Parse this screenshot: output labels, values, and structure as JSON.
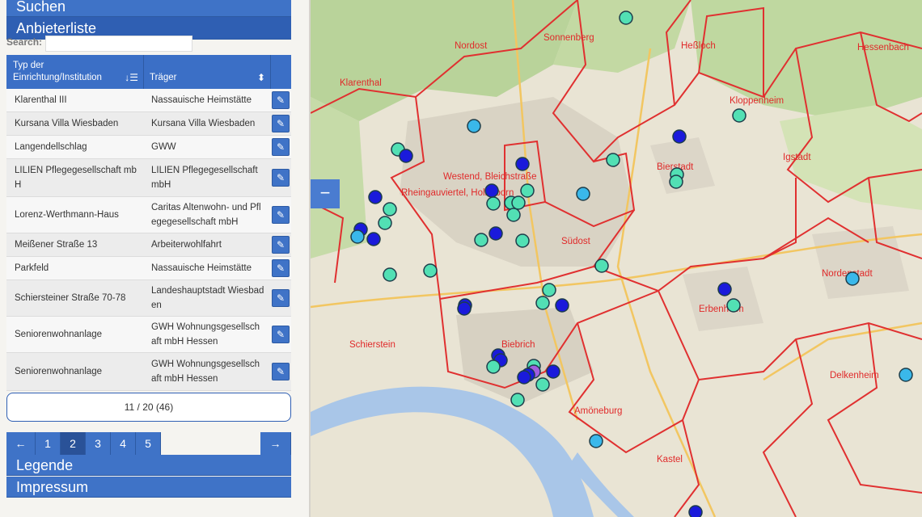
{
  "panels": {
    "search": "Suchen",
    "providers": "Anbieterliste",
    "legend": "Legende",
    "imprint": "Impressum"
  },
  "search": {
    "label": "Search:",
    "value": ""
  },
  "table": {
    "col_type": "Typ der Einrichtung/Institution",
    "col_carrier": "Träger",
    "rows": [
      {
        "name": "Klarenthal III",
        "carrier": "Nassauische Heimstätte"
      },
      {
        "name": "Kursana Villa Wiesbaden",
        "carrier": "Kursana Villa Wiesbaden"
      },
      {
        "name": "Langendellschlag",
        "carrier": "GWW"
      },
      {
        "name": "LILIEN Pflegegesellschaft mbH",
        "carrier": "LILIEN Pflegegesellschaft mbH"
      },
      {
        "name": "Lorenz-Werthmann-Haus",
        "carrier": "Caritas Altenwohn- und Pflegegesellschaft mbH"
      },
      {
        "name": "Meißener Straße 13",
        "carrier": "Arbeiterwohlfahrt"
      },
      {
        "name": "Parkfeld",
        "carrier": "Nassauische Heimstätte"
      },
      {
        "name": "Schiersteiner Straße 70-78",
        "carrier": "Landeshauptstadt Wiesbaden"
      },
      {
        "name": "Seniorenwohnanlage",
        "carrier": "GWH Wohnungsgesellschaft mbH Hessen"
      },
      {
        "name": "Seniorenwohnanlage",
        "carrier": "GWH Wohnungsgesellschaft mbH Hessen"
      }
    ]
  },
  "pagination": {
    "info": "11 / 20 (46)",
    "prev": "←",
    "next": "→",
    "pages": [
      "1",
      "2",
      "3",
      "4",
      "5"
    ],
    "current": "2"
  },
  "map": {
    "collapse": "−",
    "districts": [
      "Nordost",
      "Sonnenberg",
      "Heßloch",
      "Kloppenheim",
      "Hessenbach",
      "Klarenthal",
      "Bierstadt",
      "Igstadt",
      "Westend, Bleichstraße",
      "Rheingauviertel, Hollerborn",
      "Südost",
      "Nordenstadt",
      "Erbenheim",
      "Schierstein",
      "Biebrich",
      "Delkenheim",
      "Amöneburg",
      "Kastel"
    ],
    "colors": {
      "teal_marker": "#52e0b4",
      "blue_marker": "#1a1adb",
      "cyan_marker": "#3ab8ea",
      "purple_marker": "#a25ee0",
      "boundary": "#e03030",
      "river": "#a9c6e8"
    }
  }
}
